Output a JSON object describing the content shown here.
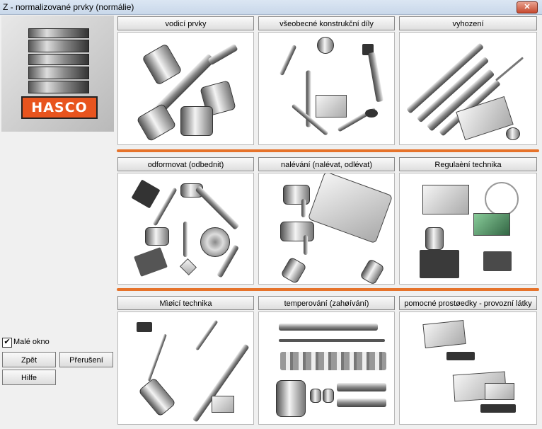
{
  "window": {
    "title": "Z - normalizované prvky (normálie)",
    "close_glyph": "✕"
  },
  "logo": {
    "text": "HASCO",
    "accent": "#e8541e"
  },
  "categories": [
    {
      "label": "vodicí prvky"
    },
    {
      "label": "všeobecné konstrukční díly"
    },
    {
      "label": "vyhození"
    },
    {
      "label": "odformovat (odbednit)"
    },
    {
      "label": "nalévání (nalévat, odlévat)"
    },
    {
      "label": "Regulaèní technika"
    },
    {
      "label": "Mìøicí technika"
    },
    {
      "label": "temperování (zahøívání)"
    },
    {
      "label": "pomocné prostøedky - provozní látky"
    }
  ],
  "options": {
    "small_window_label": "Malé okno",
    "small_window_checked": true
  },
  "buttons": {
    "back": "Zpět",
    "interrupt": "Přerušení",
    "help": "Hilfe"
  },
  "colors": {
    "separator": "#e6732b",
    "background": "#f0f0f0"
  }
}
